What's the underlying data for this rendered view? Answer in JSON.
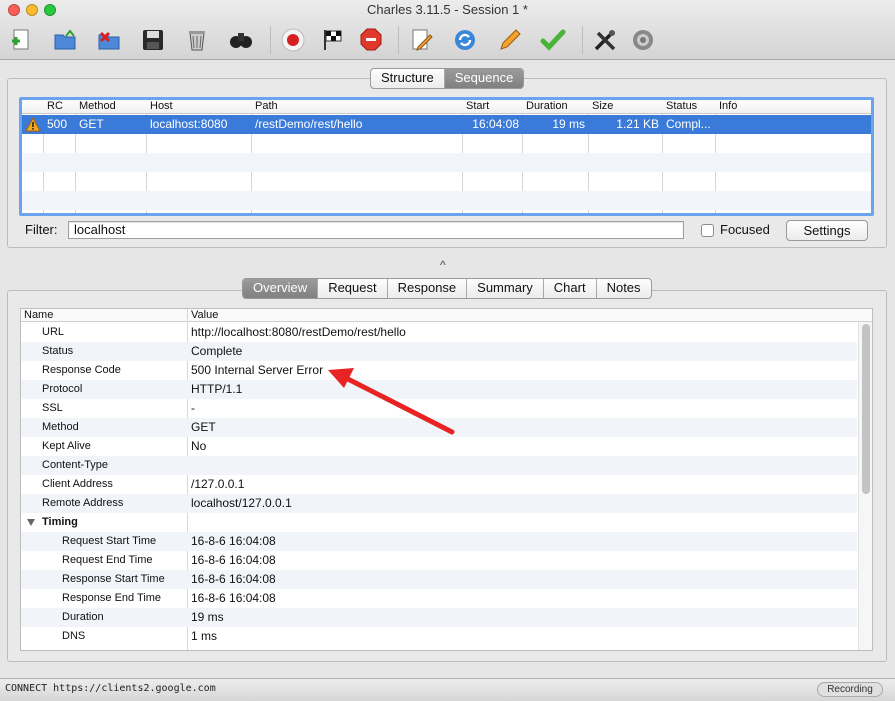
{
  "window": {
    "title": "Charles 3.11.5 - Session 1 *"
  },
  "toolbar": {
    "icons": [
      "new-session-icon",
      "open-session-icon",
      "close-session-icon",
      "save-session-icon",
      "clear-session-icon",
      "find-icon",
      "record-icon",
      "throttle-icon",
      "breakpoints-icon",
      "edit-icon",
      "repeat-icon",
      "compose-icon",
      "validate-icon",
      "tools-icon",
      "settings-icon"
    ]
  },
  "upper": {
    "tabs": [
      {
        "label": "Structure",
        "active": false
      },
      {
        "label": "Sequence",
        "active": true
      }
    ],
    "columns": [
      "RC",
      "Method",
      "Host",
      "Path",
      "Start",
      "Duration",
      "Size",
      "Status",
      "Info"
    ],
    "rows": [
      {
        "rc": "500",
        "method": "GET",
        "host": "localhost:8080",
        "path": "/restDemo/rest/hello",
        "start": "16:04:08",
        "duration": "19 ms",
        "size": "1.21 KB",
        "status": "Compl...",
        "info": ""
      }
    ],
    "filter_label": "Filter:",
    "filter_value": "localhost",
    "focused_label": "Focused",
    "settings_label": "Settings"
  },
  "splitter_glyph": "^",
  "lower": {
    "tabs": [
      {
        "label": "Overview",
        "active": true
      },
      {
        "label": "Request",
        "active": false
      },
      {
        "label": "Response",
        "active": false
      },
      {
        "label": "Summary",
        "active": false
      },
      {
        "label": "Chart",
        "active": false
      },
      {
        "label": "Notes",
        "active": false
      }
    ],
    "header_name": "Name",
    "header_value": "Value",
    "rows": [
      {
        "name": "URL",
        "value": "http://localhost:8080/restDemo/rest/hello"
      },
      {
        "name": "Status",
        "value": "Complete"
      },
      {
        "name": "Response Code",
        "value": "500 Internal Server Error"
      },
      {
        "name": "Protocol",
        "value": "HTTP/1.1"
      },
      {
        "name": "SSL",
        "value": "-"
      },
      {
        "name": "Method",
        "value": "GET"
      },
      {
        "name": "Kept Alive",
        "value": "No"
      },
      {
        "name": "Content-Type",
        "value": ""
      },
      {
        "name": "Client Address",
        "value": "/127.0.0.1"
      },
      {
        "name": "Remote Address",
        "value": "localhost/127.0.0.1"
      },
      {
        "name": "Timing",
        "value": ""
      },
      {
        "name": "Request Start Time",
        "value": "16-8-6 16:04:08"
      },
      {
        "name": "Request End Time",
        "value": "16-8-6 16:04:08"
      },
      {
        "name": "Response Start Time",
        "value": "16-8-6 16:04:08"
      },
      {
        "name": "Response End Time",
        "value": "16-8-6 16:04:08"
      },
      {
        "name": "Duration",
        "value": "19 ms"
      },
      {
        "name": "DNS",
        "value": "1 ms"
      }
    ]
  },
  "statusbar": {
    "text": "CONNECT https://clients2.google.com",
    "recording_label": "Recording"
  },
  "colors": {
    "selection": "#3a7ad9",
    "annotation_arrow": "#e82323",
    "warning": "#f5a623"
  }
}
